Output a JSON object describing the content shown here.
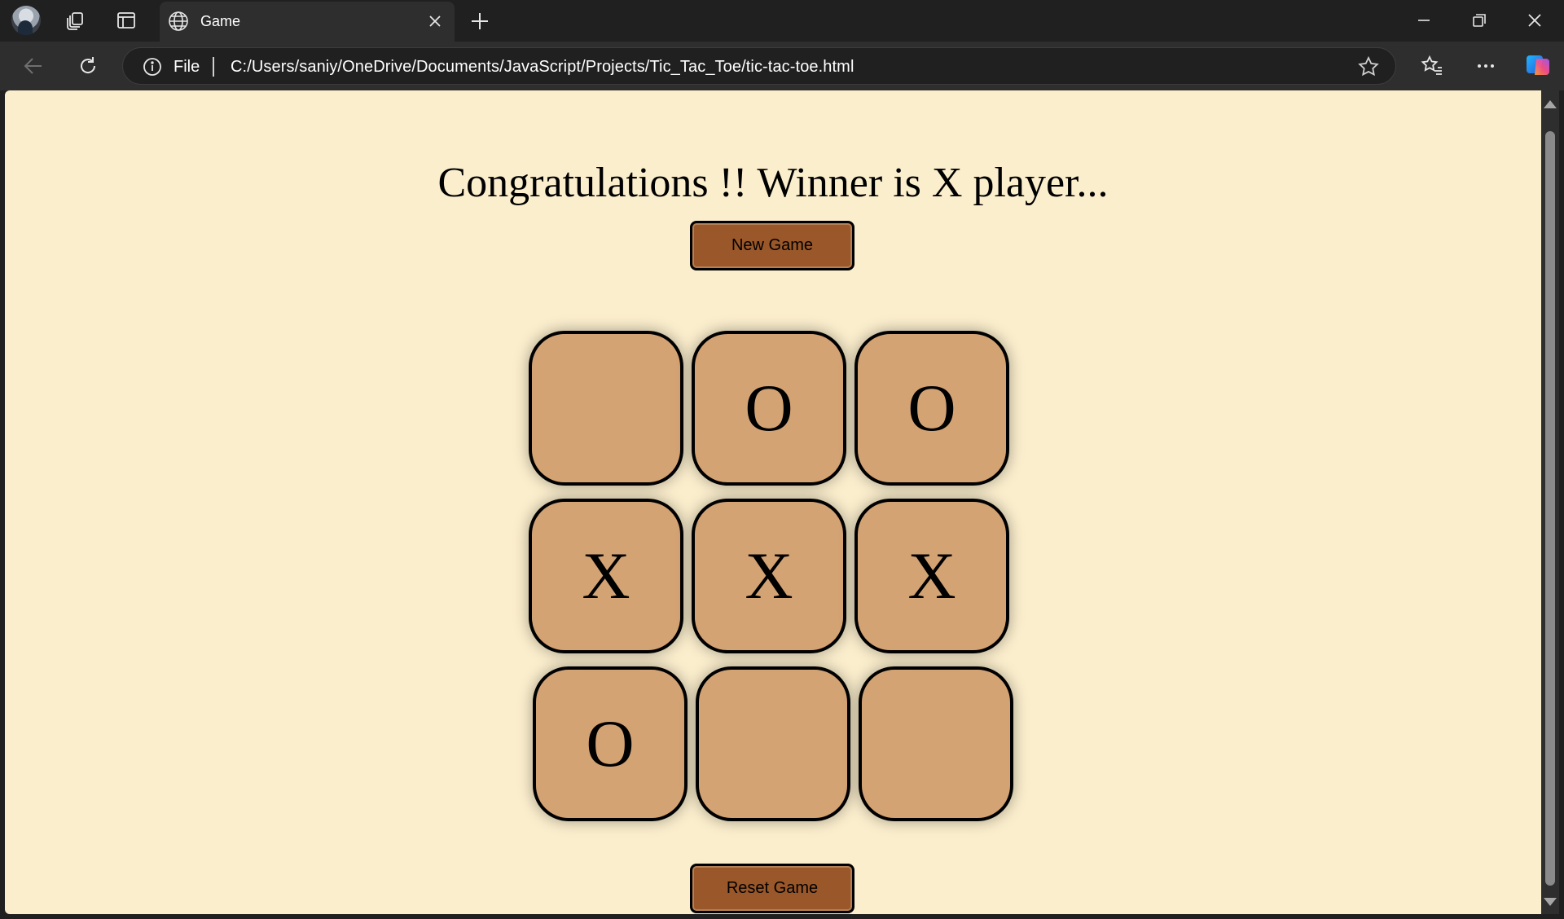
{
  "browser": {
    "tab_title": "Game",
    "address_scheme": "File",
    "url": "C:/Users/saniy/OneDrive/Documents/JavaScript/Projects/Tic_Tac_Toe/tic-tac-toe.html"
  },
  "game": {
    "message": "Congratulations !! Winner is X player...",
    "new_game_label": "New Game",
    "reset_label": "Reset Game",
    "board": [
      [
        "",
        "O",
        "O"
      ],
      [
        "X",
        "X",
        "X"
      ],
      [
        "O",
        "",
        ""
      ]
    ]
  },
  "colors": {
    "page_bg": "#fbeecd",
    "cell_bg": "#d4a374",
    "button_bg": "#9a5729"
  }
}
